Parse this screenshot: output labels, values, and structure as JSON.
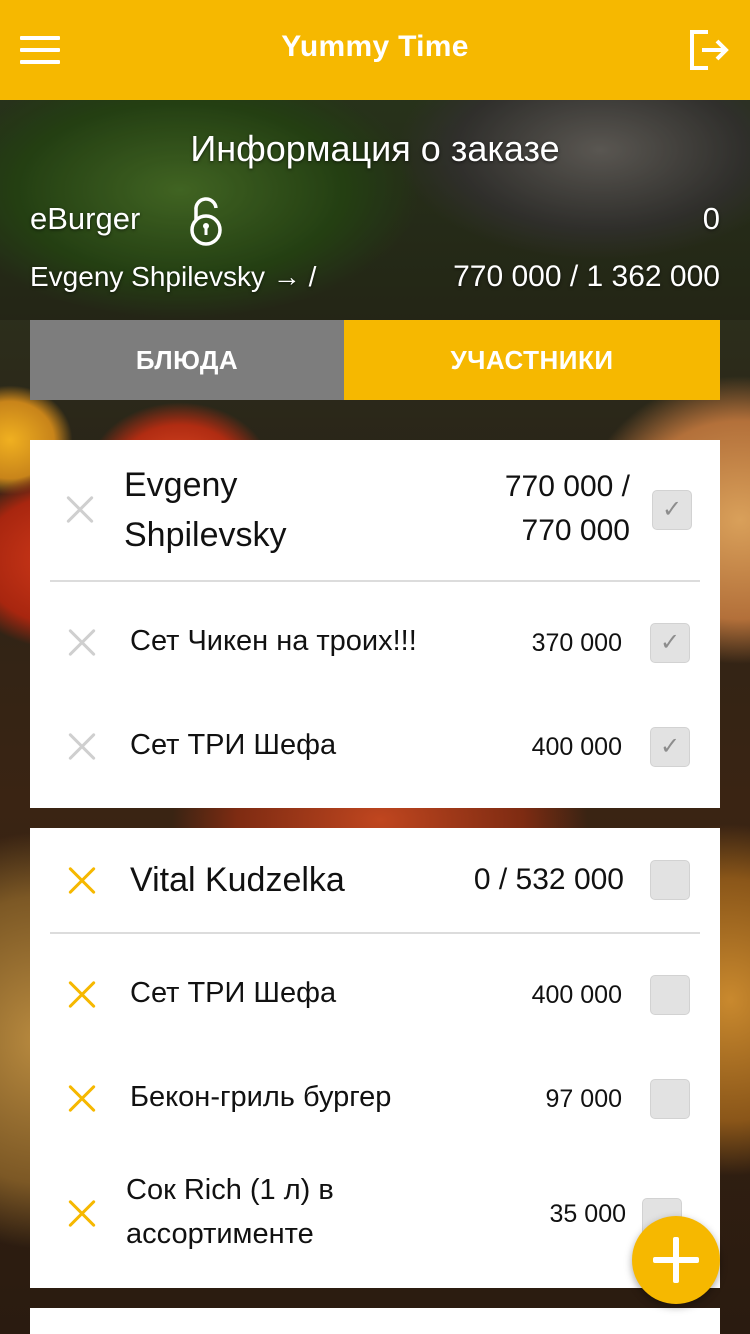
{
  "header": {
    "title": "Yummy Time",
    "menu_icon": "hamburger-menu-icon",
    "logout_icon": "logout-icon"
  },
  "order": {
    "title": "Информация о заказе",
    "restaurant": "eBurger",
    "lock_icon": "unlocked-padlock-icon",
    "count": "0",
    "owner": "Evgeny Shpilevsky → /",
    "totals": "770 000 / 1 362 000"
  },
  "tabs": [
    {
      "label": "БЛЮДА",
      "active": false
    },
    {
      "label": "УЧАСТНИКИ",
      "active": true
    }
  ],
  "participants": [
    {
      "name_line1": "Evgeny",
      "name_line2": "Shpilevsky",
      "amount_line1": "770 000 /",
      "amount_line2": "770 000",
      "paid": true,
      "items": [
        {
          "name": "Сет Чикен на троих!!!",
          "price": "370 000",
          "paid": true
        },
        {
          "name": "Сет ТРИ Шефа",
          "price": "400 000",
          "paid": true
        }
      ]
    },
    {
      "name": "Vital Kudzelka",
      "amount": "0 / 532 000",
      "paid": false,
      "items": [
        {
          "name": "Сет ТРИ Шефа",
          "price": "400 000",
          "paid": false
        },
        {
          "name": "Бекон-гриль бургер",
          "price": "97 000",
          "paid": false
        },
        {
          "name_line1": "Сок Rich (1 л) в",
          "name_line2": "ассортименте",
          "price": "35 000",
          "paid": false
        }
      ]
    }
  ],
  "checkmark": "✓",
  "colors": {
    "accent": "#f6b800",
    "tab_inactive": "#7d7d7d",
    "remove_disabled": "#cfcfcf"
  }
}
